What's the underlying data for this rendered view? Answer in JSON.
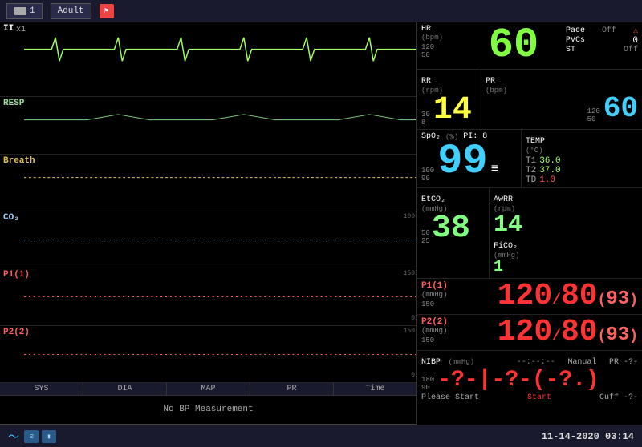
{
  "topbar": {
    "bed_number": "1",
    "mode": "Adult",
    "ecg_lead": "II",
    "ecg_gain": "x1"
  },
  "hr": {
    "label": "HR",
    "unit": "(bpm)",
    "scale_high": "120",
    "scale_low": "50",
    "value": "60",
    "pace_label": "Pace",
    "pace_value": "Off",
    "pvcs_label": "PVCs",
    "pvcs_value": "0",
    "st_label": "ST",
    "st_value": "Off"
  },
  "rr": {
    "label": "RR",
    "unit": "(rpm)",
    "scale_high": "30",
    "scale_low": "8",
    "value": "14"
  },
  "pr_right": {
    "label": "PR",
    "unit": "(bpm)",
    "scale_high": "120",
    "scale_low": "50",
    "value": "60"
  },
  "spo2": {
    "label": "SpO₂",
    "unit": "(%)",
    "pi_label": "PI:",
    "pi_value": "8",
    "scale_high": "100",
    "scale_low": "90",
    "value": "99"
  },
  "temp": {
    "label": "TEMP",
    "unit": "(°C)",
    "t1_label": "T1",
    "t1_value": "36.0",
    "t2_label": "T2",
    "t2_value": "37.0",
    "td_label": "TD",
    "td_value": "1.0"
  },
  "etco2": {
    "label": "EtCO₂",
    "unit": "(mmHg)",
    "scale_high": "50",
    "scale_mid": "25",
    "value": "38"
  },
  "awrr": {
    "label": "AwRR",
    "unit": "(rpm)",
    "value": "14"
  },
  "fico2": {
    "label": "FiCO₂",
    "unit": "(mmHg)",
    "value": "1"
  },
  "p1": {
    "label": "P1(1)",
    "unit": "(mmHg)",
    "scale": "150",
    "value_sys": "120",
    "value_dia": "80",
    "value_map": "93"
  },
  "p2": {
    "label": "P2(2)",
    "unit": "(mmHg)",
    "scale": "150",
    "value_sys": "120",
    "value_dia": "80",
    "value_map": "93"
  },
  "nibp": {
    "label": "NIBP",
    "unit": "(mmHg)",
    "scale_high": "180",
    "scale_low": "90",
    "timer": "--:--:--",
    "manual_label": "Manual",
    "pr_label": "PR -?-",
    "value_display": "-?-|-?-(-?.)",
    "please_start": "Please Start",
    "start_word": "Start",
    "cuff_label": "Cuff -?-"
  },
  "nibp_table": {
    "headers": [
      "SYS",
      "DIA",
      "MAP",
      "PR",
      "Time"
    ],
    "no_measurement": "No BP Measurement"
  },
  "waveforms": {
    "ecg_label": "II",
    "ecg_gain": "x1",
    "resp_label": "RESP",
    "breath_label": "Breath",
    "co2_label": "CO₂",
    "co2_scale": "100",
    "p1_label": "P1(1)",
    "p1_scale": "150",
    "p1_scale_low": "0",
    "p2_label": "P2(2)",
    "p2_scale": "150",
    "p2_scale_low": "0"
  },
  "bottom": {
    "datetime": "11-14-2020  03:14"
  }
}
